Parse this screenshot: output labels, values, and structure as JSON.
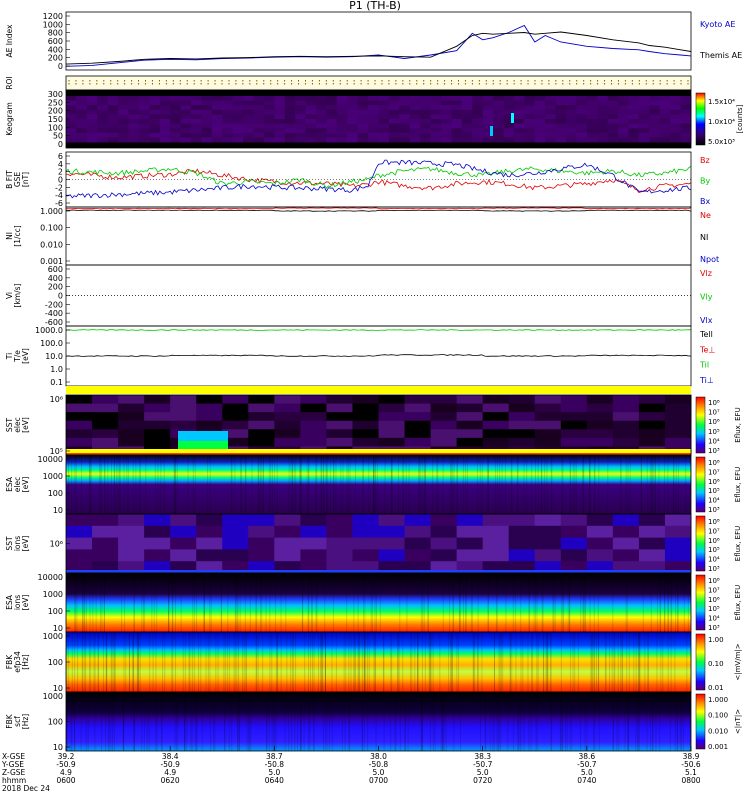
{
  "title": "P1 (TH-B)",
  "colors": {
    "blue": "#0000c8",
    "red": "#e00000",
    "green": "#00c800",
    "black": "#000000",
    "yellow": "#ffff00",
    "bg_dark": "#20002a"
  },
  "chart_data": [
    {
      "type": "line",
      "panel": "ae",
      "ylabel": "AE Index",
      "ylim": [
        0,
        1200
      ],
      "yticks": [
        "1200",
        "1000",
        "800",
        "600",
        "400",
        "200",
        "0"
      ],
      "legend": [
        "Kyoto AE",
        "Themis AE"
      ],
      "series": [
        {
          "name": "Kyoto AE",
          "color": "#0000c8",
          "x": [
            0,
            5,
            10,
            15,
            20,
            25,
            30,
            35,
            40,
            45,
            50,
            55,
            60,
            65,
            70,
            75,
            78,
            80,
            82,
            85,
            88,
            90,
            92,
            95,
            100,
            105,
            110,
            112,
            115,
            118,
            120
          ],
          "values": [
            40,
            60,
            120,
            180,
            200,
            190,
            220,
            230,
            250,
            260,
            250,
            260,
            300,
            220,
            300,
            400,
            800,
            650,
            700,
            820,
            980,
            600,
            750,
            600,
            500,
            450,
            420,
            380,
            330,
            300,
            280
          ]
        },
        {
          "name": "Themis AE",
          "color": "#000000",
          "x": [
            0,
            5,
            10,
            15,
            20,
            25,
            30,
            35,
            40,
            45,
            50,
            55,
            60,
            65,
            70,
            75,
            78,
            80,
            82,
            85,
            88,
            90,
            92,
            95,
            100,
            105,
            110,
            112,
            115,
            118,
            120
          ],
          "values": [
            90,
            110,
            150,
            200,
            220,
            210,
            230,
            240,
            260,
            270,
            260,
            270,
            280,
            260,
            250,
            500,
            750,
            800,
            780,
            800,
            820,
            780,
            800,
            830,
            750,
            650,
            580,
            520,
            480,
            420,
            380
          ]
        }
      ]
    },
    {
      "type": "heatmap",
      "panel": "roi",
      "ylabel": "ROI"
    },
    {
      "type": "heatmap",
      "panel": "keogram",
      "ylabel": "Keogram",
      "yticks": [
        "300",
        "250",
        "200",
        "150",
        "100",
        "50",
        "0"
      ],
      "colorbar_label": "[counts]",
      "colorbar_ticks": [
        "1.5x10⁴",
        "1.0x10⁴",
        "5.0x10³"
      ]
    },
    {
      "type": "line",
      "panel": "bfield",
      "ylabel": "B FIT\nGSE\n[nT]",
      "ylim": [
        -6,
        6
      ],
      "yticks": [
        "6",
        "4",
        "2",
        "0",
        "-2",
        "-4",
        "-6"
      ],
      "legend": [
        "Bz",
        "By",
        "Bx"
      ],
      "series": [
        {
          "name": "Bz",
          "color": "#e00000",
          "x": [
            0,
            10,
            20,
            25,
            30,
            35,
            40,
            45,
            50,
            55,
            58,
            60,
            65,
            70,
            75,
            80,
            85,
            90,
            95,
            100,
            105,
            110,
            115,
            120
          ],
          "values": [
            1.5,
            0.5,
            1.2,
            2.0,
            1.0,
            0.0,
            -0.5,
            -0.8,
            -1.0,
            -1.5,
            -1.2,
            -0.5,
            -1.5,
            -2.0,
            -1.0,
            -0.5,
            -1.0,
            -2.0,
            -1.5,
            -1.0,
            0.0,
            -2.5,
            -1.5,
            -1.0
          ]
        },
        {
          "name": "By",
          "color": "#00c800",
          "x": [
            0,
            10,
            20,
            25,
            30,
            35,
            40,
            45,
            50,
            55,
            58,
            60,
            65,
            70,
            75,
            80,
            85,
            90,
            95,
            100,
            105,
            110,
            115,
            120
          ],
          "values": [
            2.0,
            1.5,
            2.5,
            1.5,
            -1.0,
            -0.5,
            -1.0,
            0.0,
            -1.5,
            -0.5,
            0.0,
            1.0,
            2.0,
            2.5,
            1.5,
            1.0,
            2.0,
            2.5,
            2.0,
            1.5,
            2.0,
            1.0,
            1.5,
            2.5
          ]
        },
        {
          "name": "Bx",
          "color": "#0000c8",
          "x": [
            0,
            10,
            20,
            25,
            30,
            35,
            40,
            45,
            50,
            55,
            58,
            60,
            65,
            70,
            75,
            80,
            85,
            90,
            95,
            100,
            105,
            110,
            115,
            120
          ],
          "values": [
            -4.0,
            -3.5,
            -3.0,
            -2.5,
            -2.0,
            -1.5,
            -1.8,
            -2.0,
            -2.2,
            -2.5,
            -1.5,
            4.0,
            4.0,
            3.8,
            3.5,
            2.0,
            1.0,
            1.5,
            2.5,
            3.5,
            1.0,
            -3.0,
            -2.5,
            -2.0
          ]
        }
      ]
    },
    {
      "type": "line",
      "panel": "ni",
      "ylabel": "NI\n[1/cc]",
      "yticks": [
        "1.000",
        "0.100",
        "0.010",
        "0.001"
      ],
      "legend": [
        "Ne",
        "NI",
        "Npot"
      ],
      "series": [
        {
          "name": "Ne",
          "color": "#e00000",
          "values": [
            1.4,
            1.4,
            1.5,
            1.4,
            1.5,
            1.4,
            1.5
          ]
        },
        {
          "name": "NI",
          "color": "#000000",
          "values": [
            1.1,
            1.1,
            1.0,
            1.1,
            1.0,
            1.1,
            1.0
          ]
        }
      ]
    },
    {
      "type": "line",
      "panel": "vi",
      "ylabel": "Vi\n[km/s]",
      "ylim": [
        -600,
        600
      ],
      "yticks": [
        "600",
        "400",
        "200",
        "0",
        "-200",
        "-400",
        "-600"
      ],
      "legend": [
        "Vlz",
        "Vly",
        "Vlx"
      ]
    },
    {
      "type": "line",
      "panel": "ti",
      "ylabel": "Ti\nT/e\n[eV]",
      "yticks": [
        "1000.0",
        "100.0",
        "10.0",
        "1.0",
        "0.1"
      ],
      "legend": [
        "Tell",
        "Te⊥",
        "Til",
        "Ti⊥"
      ],
      "series": [
        {
          "name": "Tell",
          "color": "#000000",
          "values": [
            10,
            11,
            10,
            12,
            10,
            11,
            10
          ]
        },
        {
          "name": "Til",
          "color": "#00c800",
          "values": [
            1000,
            1000,
            1000,
            1000,
            1000,
            1000,
            1000
          ]
        }
      ]
    },
    {
      "type": "heatmap",
      "panel": "sst_e",
      "ylabel": "SST\nelec\n[eV]",
      "yticks": [
        "10⁶",
        "10⁵"
      ],
      "colorbar_ticks": [
        "10⁸",
        "10⁷",
        "10⁶",
        "10⁵",
        "10⁴",
        "10³"
      ],
      "colorbar_label": "Eflux, EFU"
    },
    {
      "type": "heatmap",
      "panel": "esa_e",
      "ylabel": "ESA\nelec\n[eV]",
      "yticks": [
        "10000",
        "1000",
        "100",
        "10"
      ],
      "colorbar_ticks": [
        "10⁸",
        "10⁷",
        "10⁶",
        "10⁵",
        "10⁴",
        "10³"
      ],
      "colorbar_label": "Eflux, EFU"
    },
    {
      "type": "heatmap",
      "panel": "sst_i",
      "ylabel": "SST\nions\n[eV]",
      "yticks": [
        "10⁶"
      ],
      "colorbar_ticks": [
        "10⁸",
        "10⁷",
        "10⁶",
        "10⁵",
        "10⁴",
        "10³"
      ],
      "colorbar_label": "Eflux, EFU"
    },
    {
      "type": "heatmap",
      "panel": "esa_i",
      "ylabel": "ESA\nions\n[eV]",
      "yticks": [
        "10000",
        "1000",
        "100",
        "10"
      ],
      "colorbar_ticks": [
        "10⁸",
        "10⁷",
        "10⁶",
        "10⁵",
        "10⁴",
        "10³"
      ],
      "colorbar_label": "Eflux, EFU"
    },
    {
      "type": "heatmap",
      "panel": "fbk_e",
      "ylabel": "FBK\nefp34\n[Hz]",
      "yticks": [
        "1000",
        "100",
        "10"
      ],
      "colorbar_ticks": [
        "1.00",
        "0.10",
        "0.01"
      ],
      "colorbar_label": "<|mV/m|>"
    },
    {
      "type": "heatmap",
      "panel": "fbk_b",
      "ylabel": "FBK\nscf\n[Hz]",
      "yticks": [
        "1000",
        "100",
        "10"
      ],
      "colorbar_ticks": [
        "1.000",
        "0.100",
        "0.010",
        "0.001"
      ],
      "colorbar_label": "<|nT|>"
    }
  ],
  "x_axis": {
    "rows": [
      {
        "label": "X-GSE",
        "values": [
          "39.2",
          "38.4",
          "38.7",
          "38.0",
          "38.3",
          "38.6",
          "38.9"
        ]
      },
      {
        "label": "Y-GSE",
        "values": [
          "-50.9",
          "-50.9",
          "-50.8",
          "-50.8",
          "-50.7",
          "-50.7",
          "-50.6"
        ]
      },
      {
        "label": "Z-GSE",
        "values": [
          "4.9",
          "4.9",
          "5.0",
          "5.0",
          "5.0",
          "5.0",
          "5.1"
        ]
      },
      {
        "label": "hhmm",
        "values": [
          "0600",
          "0620",
          "0640",
          "0700",
          "0720",
          "0740",
          "0800"
        ]
      }
    ],
    "date": "2018 Dec 24"
  }
}
